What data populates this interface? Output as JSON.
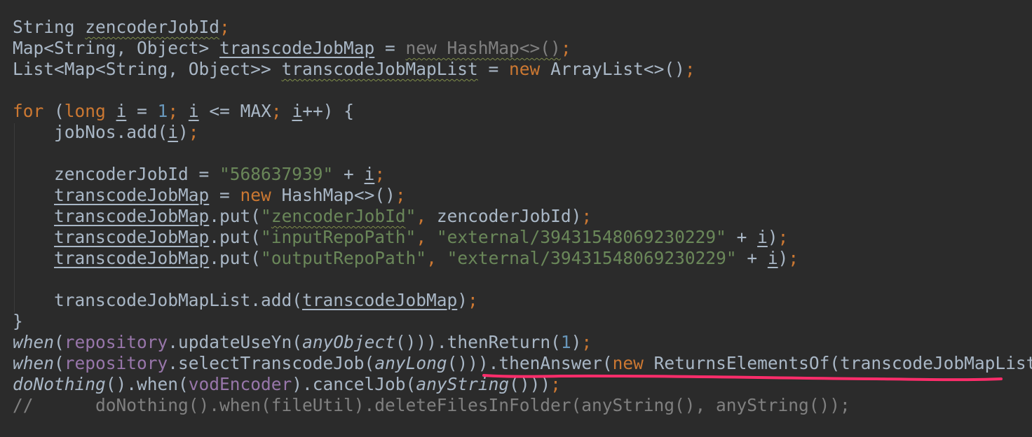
{
  "editor": {
    "theme_colors": {
      "background": "#2b2b2b",
      "text": "#a9b7c6",
      "keyword": "#cc7832",
      "string": "#6a8759",
      "number": "#6897bb",
      "field": "#9876aa",
      "comment": "#808080",
      "annotation_underline": "#ff2d6b"
    },
    "lines": [
      [
        {
          "t": "String "
        },
        {
          "t": "zencoderJobId",
          "c": "t-warn"
        },
        {
          "t": ";",
          "c": "t-kw"
        }
      ],
      [
        {
          "t": "Map<String, Object> "
        },
        {
          "t": "transcodeJobMap",
          "c": "t-ul"
        },
        {
          "t": " = "
        },
        {
          "t": "new HashMap<>()",
          "c": "t-gray t-warn"
        },
        {
          "t": ";",
          "c": "t-kw"
        }
      ],
      [
        {
          "t": "List<Map<String, Object>> "
        },
        {
          "t": "transcodeJobMapList",
          "c": "t-warn"
        },
        {
          "t": " = "
        },
        {
          "t": "new",
          "c": "t-kw"
        },
        {
          "t": " ArrayList<>()"
        },
        {
          "t": ";",
          "c": "t-kw"
        }
      ],
      [],
      [
        {
          "t": "for",
          "c": "t-kw"
        },
        {
          "t": " ("
        },
        {
          "t": "long",
          "c": "t-kw"
        },
        {
          "t": " "
        },
        {
          "t": "i",
          "c": "t-ul"
        },
        {
          "t": " = "
        },
        {
          "t": "1",
          "c": "t-num"
        },
        {
          "t": ";",
          "c": "t-kw"
        },
        {
          "t": " "
        },
        {
          "t": "i",
          "c": "t-ul"
        },
        {
          "t": " <= MAX"
        },
        {
          "t": ";",
          "c": "t-kw"
        },
        {
          "t": " "
        },
        {
          "t": "i",
          "c": "t-ul"
        },
        {
          "t": "++) {"
        }
      ],
      [
        {
          "t": "    jobNos.add("
        },
        {
          "t": "i",
          "c": "t-ul"
        },
        {
          "t": ")"
        },
        {
          "t": ";",
          "c": "t-kw"
        }
      ],
      [],
      [
        {
          "t": "    zencoderJobId = "
        },
        {
          "t": "\"568637939\"",
          "c": "t-str"
        },
        {
          "t": " + "
        },
        {
          "t": "i",
          "c": "t-ul"
        },
        {
          "t": ";",
          "c": "t-kw"
        }
      ],
      [
        {
          "t": "    "
        },
        {
          "t": "transcodeJobMap",
          "c": "t-ul"
        },
        {
          "t": " = "
        },
        {
          "t": "new",
          "c": "t-kw"
        },
        {
          "t": " HashMap<>()"
        },
        {
          "t": ";",
          "c": "t-kw"
        }
      ],
      [
        {
          "t": "    "
        },
        {
          "t": "transcodeJobMap",
          "c": "t-ul"
        },
        {
          "t": ".put("
        },
        {
          "t": "\"",
          "c": "t-str"
        },
        {
          "t": "zencoderJobId",
          "c": "t-str t-warn"
        },
        {
          "t": "\"",
          "c": "t-str"
        },
        {
          "t": ", ",
          "c": "t-kw"
        },
        {
          "t": "zencoderJobId)"
        },
        {
          "t": ";",
          "c": "t-kw"
        }
      ],
      [
        {
          "t": "    "
        },
        {
          "t": "transcodeJobMap",
          "c": "t-ul"
        },
        {
          "t": ".put("
        },
        {
          "t": "\"inputRepoPath\"",
          "c": "t-str"
        },
        {
          "t": ", ",
          "c": "t-kw"
        },
        {
          "t": "\"external/39431548069230229\"",
          "c": "t-str"
        },
        {
          "t": " + "
        },
        {
          "t": "i",
          "c": "t-ul"
        },
        {
          "t": ")"
        },
        {
          "t": ";",
          "c": "t-kw"
        }
      ],
      [
        {
          "t": "    "
        },
        {
          "t": "transcodeJobMap",
          "c": "t-ul"
        },
        {
          "t": ".put("
        },
        {
          "t": "\"outputRepoPath\"",
          "c": "t-str"
        },
        {
          "t": ", ",
          "c": "t-kw"
        },
        {
          "t": "\"external/39431548069230229\"",
          "c": "t-str"
        },
        {
          "t": " + "
        },
        {
          "t": "i",
          "c": "t-ul"
        },
        {
          "t": ")"
        },
        {
          "t": ";",
          "c": "t-kw"
        }
      ],
      [],
      [
        {
          "t": "    transcodeJobMapList.add("
        },
        {
          "t": "transcodeJobMap",
          "c": "t-ul"
        },
        {
          "t": ")"
        },
        {
          "t": ";",
          "c": "t-kw"
        }
      ],
      [
        {
          "t": "}"
        }
      ],
      [
        {
          "t": "when",
          "c": "t-ita"
        },
        {
          "t": "("
        },
        {
          "t": "repository",
          "c": "t-fld"
        },
        {
          "t": ".updateUseYn("
        },
        {
          "t": "anyObject",
          "c": "t-ita"
        },
        {
          "t": "())).thenReturn("
        },
        {
          "t": "1",
          "c": "t-num"
        },
        {
          "t": ")"
        },
        {
          "t": ";",
          "c": "t-kw"
        }
      ],
      [
        {
          "t": "when",
          "c": "t-ita"
        },
        {
          "t": "("
        },
        {
          "t": "repository",
          "c": "t-fld"
        },
        {
          "t": ".selectTranscodeJob("
        },
        {
          "t": "anyLong",
          "c": "t-ita"
        },
        {
          "t": "())).thenAnswer("
        },
        {
          "t": "new",
          "c": "t-kw"
        },
        {
          "t": " ReturnsElementsOf(transcodeJobMapList))"
        },
        {
          "t": ";",
          "c": "t-kw"
        }
      ],
      [
        {
          "t": "doNothing",
          "c": "t-ita"
        },
        {
          "t": "().when("
        },
        {
          "t": "vodEncoder",
          "c": "t-fld"
        },
        {
          "t": ").cancelJob("
        },
        {
          "t": "anyString",
          "c": "t-ita"
        },
        {
          "t": "()))"
        },
        {
          "t": ";",
          "c": "t-kw"
        }
      ],
      [
        {
          "t": "//      doNothing().when(fileUtil).deleteFilesInFolder(anyString(), anyString());",
          "c": "t-cmt"
        }
      ]
    ]
  }
}
